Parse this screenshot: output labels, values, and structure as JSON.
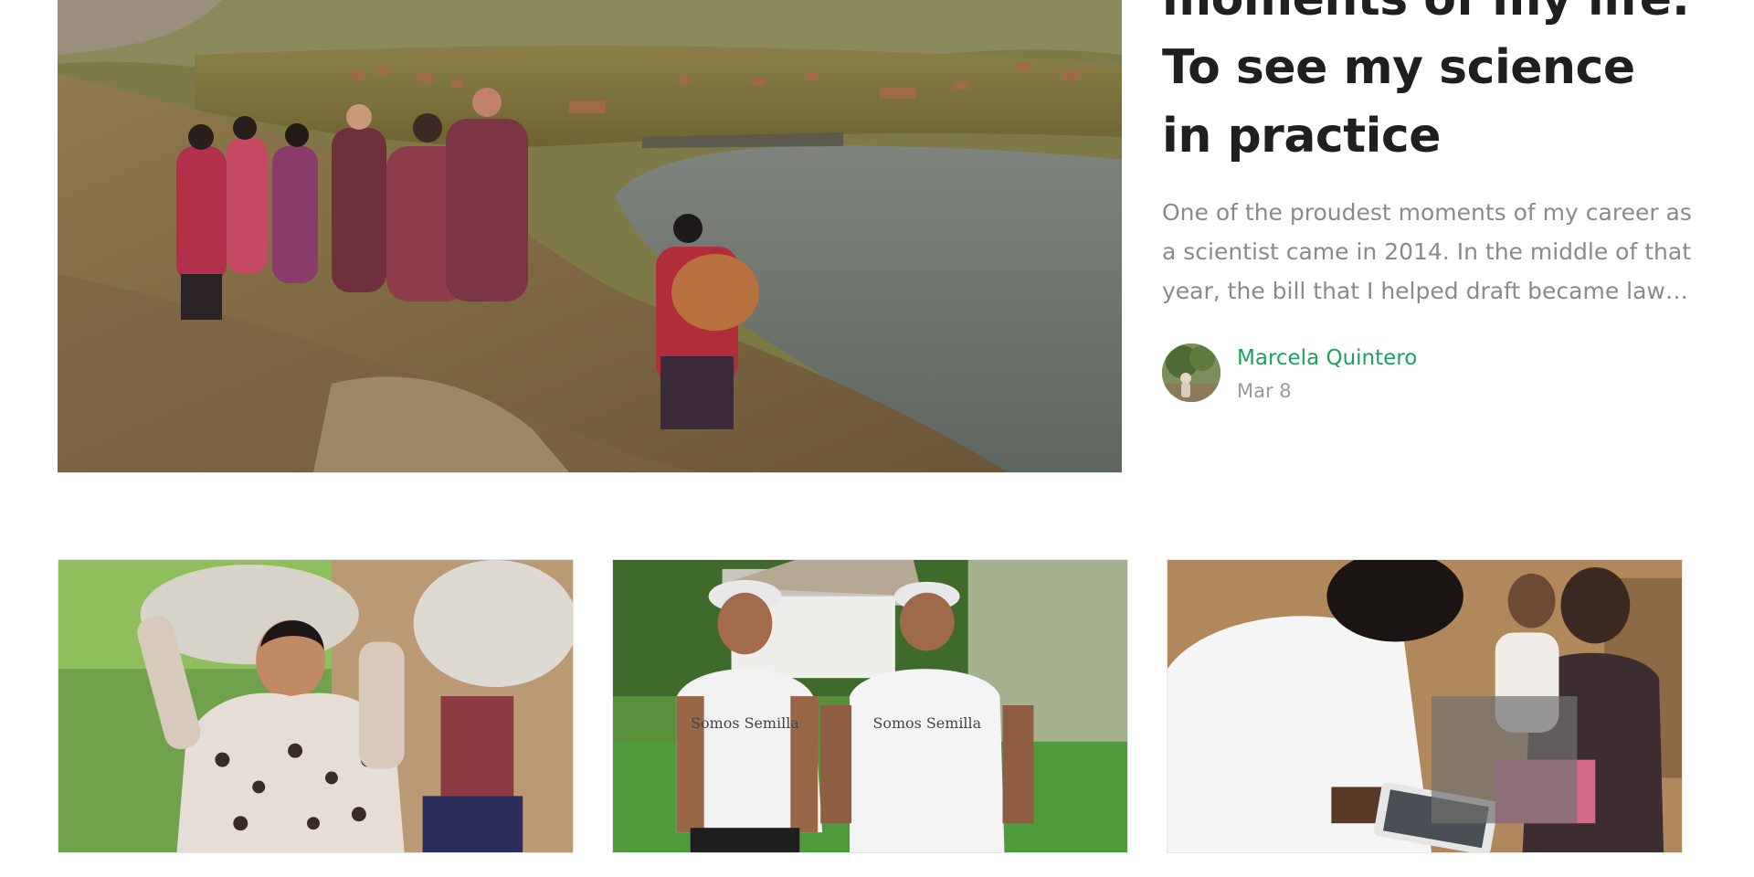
{
  "hero": {
    "title": "moments of my life:\nTo see my science\nin practice",
    "excerpt": "One of the proudest moments of my career as a scientist came in 2014. In the middle of that year, the bill that I helped draft became law…",
    "author": {
      "name": "Marcela Quintero",
      "date": "Mar 8"
    }
  },
  "cards": [
    {
      "image_subject": "woman-carrying-sack-photo"
    },
    {
      "image_subject": "two-farmers-somos-semilla-photo"
    },
    {
      "image_subject": "women-with-tablet-photo"
    }
  ],
  "card_shirt_text": "Somos Semilla"
}
